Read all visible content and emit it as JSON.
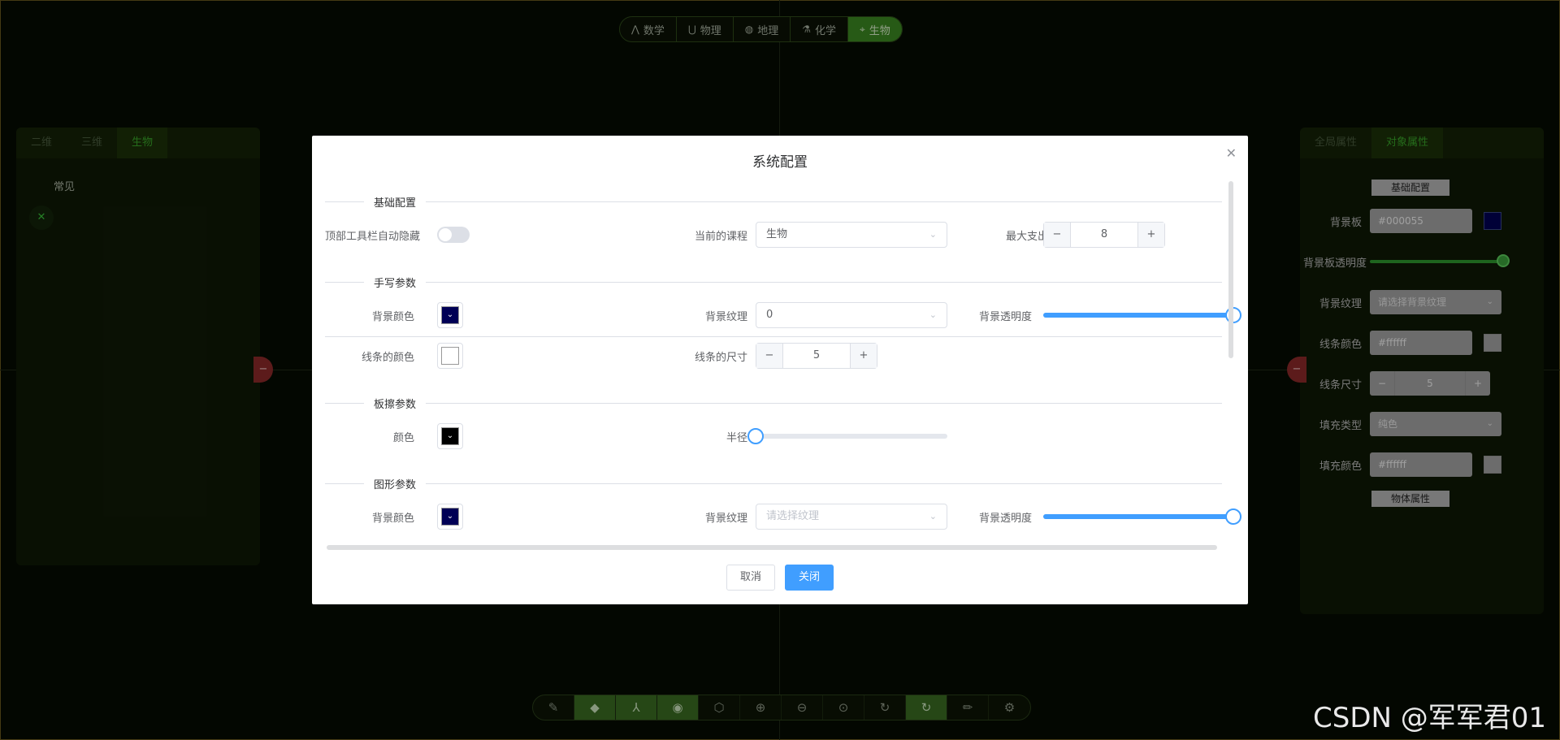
{
  "subjects": [
    {
      "label": "数学",
      "icon": "math-icon",
      "glyph": "⋀"
    },
    {
      "label": "物理",
      "icon": "magnet-icon",
      "glyph": "⋃"
    },
    {
      "label": "地理",
      "icon": "globe-icon",
      "glyph": "◍"
    },
    {
      "label": "化学",
      "icon": "flask-icon",
      "glyph": "⚗"
    },
    {
      "label": "生物",
      "icon": "dna-icon",
      "glyph": "⌖",
      "active": true
    }
  ],
  "left_panel": {
    "tabs": [
      "二维",
      "三维",
      "生物"
    ],
    "active_tab": "生物",
    "section_title": "常见",
    "item_icon": "dna-icon"
  },
  "right_panel": {
    "tabs": [
      "全局属性",
      "对象属性"
    ],
    "active_tab": "对象属性",
    "header": "基础配置",
    "bg_board_label": "背景板",
    "bg_board_value": "#000055",
    "bg_opacity_label": "背景板透明度",
    "bg_texture_label": "背景纹理",
    "bg_texture_placeholder": "请选择背景纹理",
    "line_color_label": "线条颜色",
    "line_color_value": "#ffffff",
    "line_size_label": "线条尺寸",
    "line_size_value": "5",
    "fill_type_label": "填充类型",
    "fill_type_value": "纯色",
    "fill_color_label": "填充颜色",
    "fill_color_value": "#ffffff",
    "object_props": "物体属性"
  },
  "dialog": {
    "title": "系统配置",
    "sections": {
      "basic": "基础配置",
      "handwriting": "手写参数",
      "eraser": "板擦参数",
      "shape": "图形参数"
    },
    "basic": {
      "autohide_label": "顶部工具栏自动隐藏",
      "autohide_on": false,
      "course_label": "当前的课程",
      "course_value": "生物",
      "max_label": "最大支出",
      "max_value": "8"
    },
    "handwriting": {
      "bg_color_label": "背景颜色",
      "bg_color": "#000055",
      "texture_label": "背景纹理",
      "texture_value": "0",
      "opacity_label": "背景透明度",
      "opacity": 1.0,
      "line_color_label": "线条的颜色",
      "line_color": "#ffffff",
      "line_size_label": "线条的尺寸",
      "line_size": "5"
    },
    "eraser": {
      "color_label": "颜色",
      "color": "#000000",
      "radius_label": "半径",
      "radius": 0
    },
    "shape": {
      "bg_color_label": "背景颜色",
      "bg_color": "#000055",
      "texture_label": "背景纹理",
      "texture_placeholder": "请选择纹理",
      "opacity_label": "背景透明度",
      "opacity": 1.0
    },
    "cancel_label": "取消",
    "close_label": "关闭"
  },
  "toolbar": [
    {
      "name": "brush-icon",
      "glyph": "✎"
    },
    {
      "name": "eraser-icon",
      "glyph": "◆",
      "active": true
    },
    {
      "name": "axes-icon",
      "glyph": "⅄",
      "active": true
    },
    {
      "name": "camera-icon",
      "glyph": "◉",
      "active": true
    },
    {
      "name": "cube-icon",
      "glyph": "⬡"
    },
    {
      "name": "zoom-in-icon",
      "glyph": "⊕"
    },
    {
      "name": "zoom-out-icon",
      "glyph": "⊖"
    },
    {
      "name": "zoom-reset-icon",
      "glyph": "⊙"
    },
    {
      "name": "rotate-icon",
      "glyph": "↻"
    },
    {
      "name": "rotate-active-icon",
      "glyph": "↻",
      "active": true
    },
    {
      "name": "pen-icon",
      "glyph": "✏"
    },
    {
      "name": "settings-icon",
      "glyph": "⚙"
    }
  ],
  "colors": {
    "accent_green": "#3d8a22",
    "primary_blue": "#409eff",
    "board_bg": "#000055"
  },
  "watermark": "CSDN @军军君01"
}
